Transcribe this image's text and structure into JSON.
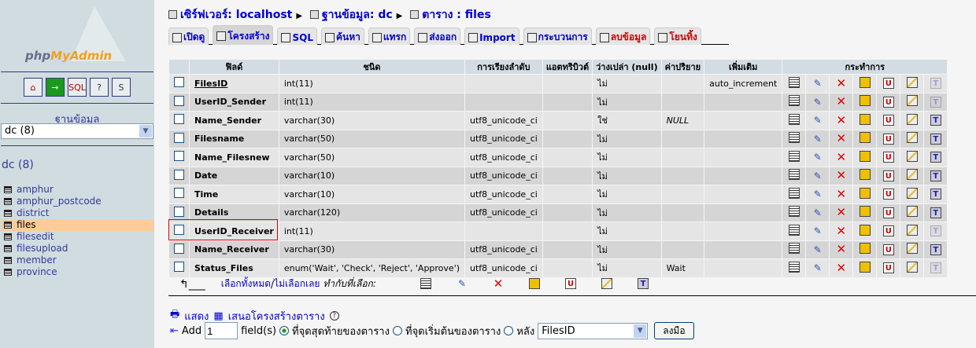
{
  "sidebar": {
    "logo": "phpMyAdmin",
    "icons": [
      "home-icon",
      "exit-icon",
      "sql-window-icon",
      "help-icon",
      "sql-docs-icon"
    ],
    "db_label": "ฐานข้อมูล",
    "db_select": "dc (8)",
    "db_name": "dc (8)",
    "tables": [
      {
        "name": "amphur"
      },
      {
        "name": "amphur_postcode"
      },
      {
        "name": "district"
      },
      {
        "name": "files",
        "selected": true
      },
      {
        "name": "filesedit"
      },
      {
        "name": "filesupload"
      },
      {
        "name": "member"
      },
      {
        "name": "province"
      }
    ]
  },
  "breadcrumb": {
    "server": "เซิร์ฟเวอร์: localhost",
    "database": "ฐานข้อมูล: dc",
    "table": "ตาราง : files"
  },
  "tabs": [
    {
      "label": "เปิดดู"
    },
    {
      "label": "โครงสร้าง",
      "active": true
    },
    {
      "label": "SQL"
    },
    {
      "label": "ค้นหา"
    },
    {
      "label": "แทรก"
    },
    {
      "label": "ส่งออก"
    },
    {
      "label": "Import"
    },
    {
      "label": "กระบวนการ"
    },
    {
      "label": "ลบข้อมูล",
      "danger": true
    },
    {
      "label": "โยนทิ้ง",
      "danger": true
    }
  ],
  "table": {
    "headers": [
      "ฟิลด์",
      "ชนิด",
      "การเรียงลำดับ",
      "แอตทริบิวต์",
      "ว่างเปล่า (null)",
      "ค่าปริยาย",
      "เพิ่มเติม",
      "กระทำการ"
    ],
    "rows": [
      {
        "field": "FilesID",
        "type": "int(11)",
        "collation": "",
        "attributes": "",
        "null": "ไม่",
        "default": "",
        "extra": "auto_increment",
        "primary": true,
        "fulltext": false
      },
      {
        "field": "UserID_Sender",
        "type": "int(11)",
        "collation": "",
        "attributes": "",
        "null": "ไม่",
        "default": "",
        "extra": "",
        "fulltext": false
      },
      {
        "field": "Name_Sender",
        "type": "varchar(30)",
        "collation": "utf8_unicode_ci",
        "attributes": "",
        "null": "ใช่",
        "default": "NULL",
        "extra": "",
        "fulltext": true
      },
      {
        "field": "Filesname",
        "type": "varchar(50)",
        "collation": "utf8_unicode_ci",
        "attributes": "",
        "null": "ไม่",
        "default": "",
        "extra": "",
        "fulltext": true
      },
      {
        "field": "Name_Filesnew",
        "type": "varchar(50)",
        "collation": "utf8_unicode_ci",
        "attributes": "",
        "null": "ไม่",
        "default": "",
        "extra": "",
        "fulltext": true
      },
      {
        "field": "Date",
        "type": "varchar(10)",
        "collation": "utf8_unicode_ci",
        "attributes": "",
        "null": "ไม่",
        "default": "",
        "extra": "",
        "fulltext": true
      },
      {
        "field": "Time",
        "type": "varchar(10)",
        "collation": "utf8_unicode_ci",
        "attributes": "",
        "null": "ไม่",
        "default": "",
        "extra": "",
        "fulltext": true
      },
      {
        "field": "Details",
        "type": "varchar(120)",
        "collation": "utf8_unicode_ci",
        "attributes": "",
        "null": "ไม่",
        "default": "",
        "extra": "",
        "fulltext": true
      },
      {
        "field": "UserID_Receiver",
        "type": "int(11)",
        "collation": "",
        "attributes": "",
        "null": "ไม่",
        "default": "",
        "extra": "",
        "fulltext": false,
        "highlighted": true
      },
      {
        "field": "Name_Receiver",
        "type": "varchar(30)",
        "collation": "utf8_unicode_ci",
        "attributes": "",
        "null": "ไม่",
        "default": "",
        "extra": "",
        "fulltext": true
      },
      {
        "field": "Status_Files",
        "type": "enum('Wait', 'Check', 'Reject', 'Approve')",
        "collation": "utf8_unicode_ci",
        "attributes": "",
        "null": "ไม่",
        "default": "Wait",
        "extra": "",
        "fulltext": false
      }
    ]
  },
  "selection": {
    "check_all": "เลือกทั้งหมด",
    "sep": " / ",
    "uncheck_all": "ไม่เลือกเลย",
    "with_selected": "ทำกับที่เลือก:"
  },
  "footer": {
    "print": "แสดง",
    "propose": "เสนอโครงสร้างตาราง",
    "add_label": "Add",
    "add_count": "1",
    "fields_label": "field(s)",
    "at_end": "ที่จุดสุดท้ายของตาราง",
    "at_begin": "ที่จุดเริ่มต้นของตาราง",
    "after": "หลัง",
    "after_field": "FilesID",
    "go": "ลงมือ"
  },
  "colors": {
    "sidebar_bg": "#d0dce0",
    "header_bg": "#d3dce3",
    "row_odd": "#e5e5e5",
    "row_even": "#d5d5d5",
    "link": "#0000cc",
    "highlight": "#e00000"
  }
}
